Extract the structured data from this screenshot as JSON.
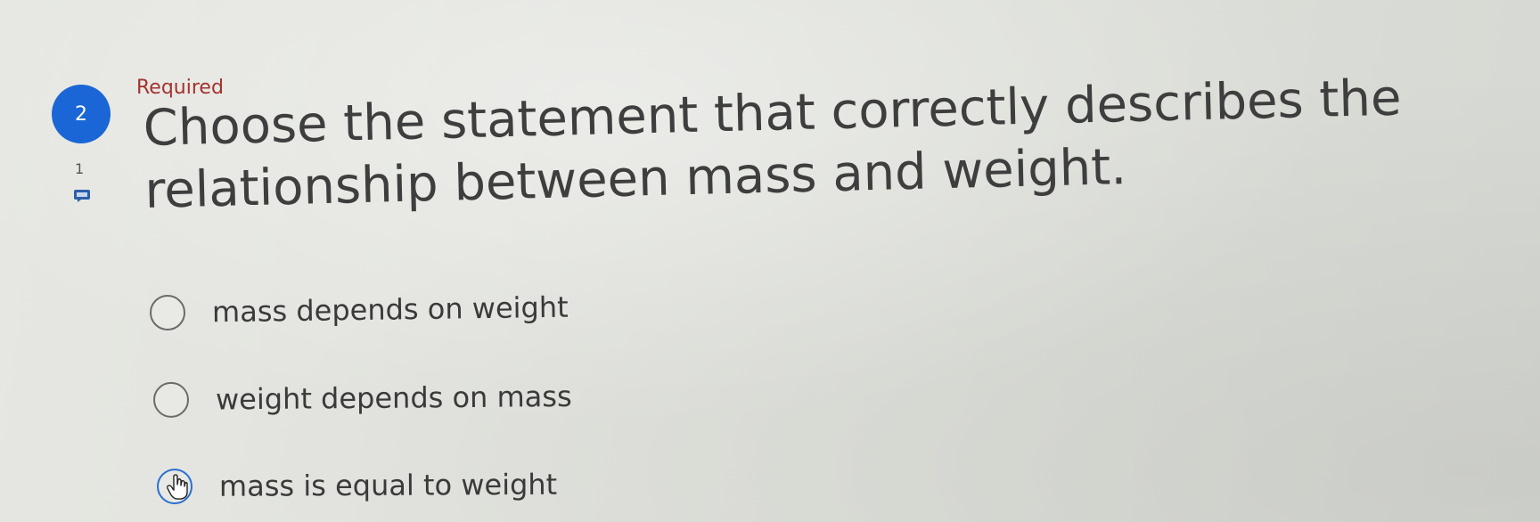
{
  "question": {
    "number": "2",
    "required_label": "Required",
    "title": "Choose the statement that correctly describes the relationship between mass and weight.",
    "note_count": "1"
  },
  "options": [
    {
      "label": "mass depends on weight",
      "selected": false
    },
    {
      "label": "weight depends on mass",
      "selected": false
    },
    {
      "label": "mass is equal to weight",
      "selected": false,
      "hovered": true
    }
  ],
  "icons": {
    "comment": "comment-icon",
    "cursor": "hand-pointer-icon"
  },
  "colors": {
    "accent": "#1a66d6",
    "required": "#a3322e",
    "text": "#3e3e3e"
  }
}
